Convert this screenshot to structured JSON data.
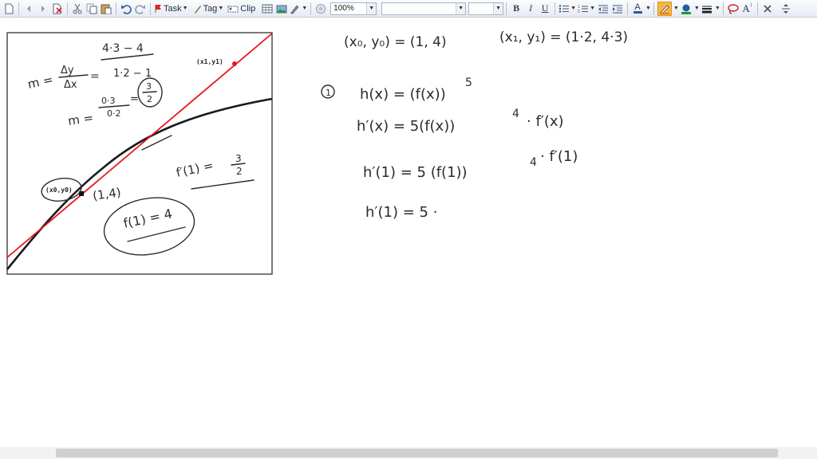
{
  "toolbar": {
    "task_label": "Task",
    "tag_label": "Tag",
    "clip_label": "Clip",
    "zoom_value": "100%",
    "font_name_value": "",
    "font_size_value": "",
    "bold_label": "B",
    "italic_label": "I",
    "underline_label": "U",
    "font_color_label": "A",
    "text_size_label": "A",
    "colors": {
      "pen": "#e87722",
      "highlight": "#1a9a3a",
      "accent": "#2c5aa0"
    }
  },
  "canvas": {
    "points": {
      "p0_label": "(x0,y0)",
      "p1_label": "(x1,y1)"
    },
    "notes": {
      "slope_lhs": "m =",
      "slope_dy": "Δy",
      "slope_dx": "Δx",
      "slope_eq": "=",
      "slope_num": "4·3 − 4",
      "slope_den": "1·2 − 1",
      "m_lhs": "m =",
      "m_num": "0·3",
      "m_den": "0·2",
      "m_eq": "=",
      "m_circ_num": "3",
      "m_circ_den": "2",
      "point_label": "(1,4)",
      "fprime_label": "f′(1) =",
      "fprime_num": "3",
      "fprime_den": "2",
      "f_value": "f(1) = 4",
      "pt0_text": "(x₀, y₀) = (1, 4)",
      "pt1_text": "(x₁, y₁) = (1·2, 4·3)",
      "step_num": "1",
      "line1": "h(x) = (f(x))",
      "line1_exp": "5",
      "line2": "h′(x) = 5(f(x))",
      "line2_exp": "4",
      "line2_tail": "· f′(x)",
      "line3": "h′(1) =  5 (f(1))",
      "line3_exp": "4",
      "line3_tail": "· f′(1)",
      "line4": "h′(1) =  5  ·"
    },
    "colors": {
      "tangent": "#e8141b",
      "curve": "#1a1a1a",
      "ink": "#2b2b2b"
    }
  }
}
